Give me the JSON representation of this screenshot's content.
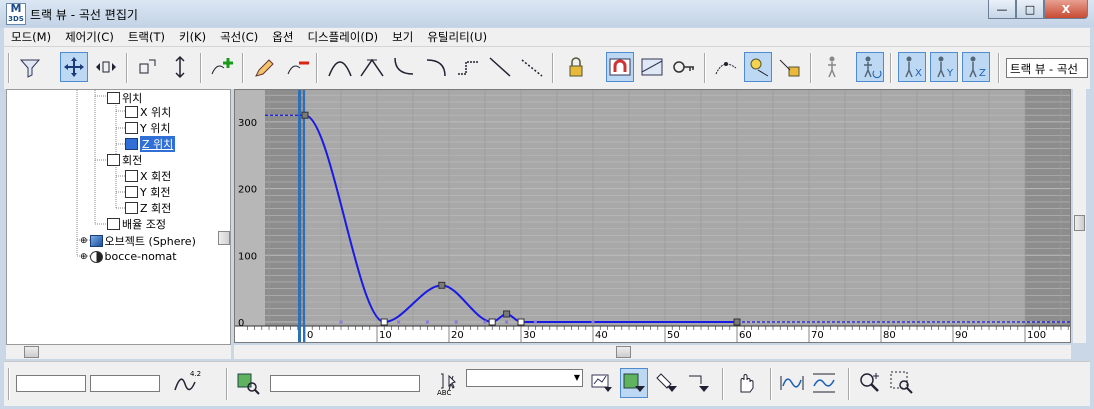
{
  "window": {
    "app_icon_text": "3DS",
    "title": "트랙 뷰 - 곡선 편집기",
    "minimize_glyph": "—",
    "maximize_glyph": "□",
    "close_glyph": "X"
  },
  "menu": [
    "모드(M)",
    "제어기(C)",
    "트랙(T)",
    "키(K)",
    "곡선(C)",
    "옵션",
    "디스플레이(D)",
    "보기",
    "유틸리티(U)"
  ],
  "toolbar": {
    "track_view_field": "트랙 뷰 - 곡선"
  },
  "tree": [
    {
      "label": "위치",
      "icon": "position-track-icon",
      "selected": false
    },
    {
      "label": "X 위치",
      "icon": "curve-track-icon",
      "selected": false
    },
    {
      "label": "Y 위치",
      "icon": "curve-track-icon",
      "selected": false
    },
    {
      "label": "Z 위치",
      "icon": "curve-track-icon",
      "selected": true
    },
    {
      "label": "회전",
      "icon": "rotation-track-icon",
      "selected": false
    },
    {
      "label": "X 회전",
      "icon": "curve-track-icon",
      "selected": false
    },
    {
      "label": "Y 회전",
      "icon": "curve-track-icon",
      "selected": false
    },
    {
      "label": "Z 회전",
      "icon": "curve-track-icon",
      "selected": false
    },
    {
      "label": "배율 조정",
      "icon": "scale-track-icon",
      "selected": false
    },
    {
      "label": "오브젝트 (Sphere)",
      "icon": "object-icon",
      "selected": false
    },
    {
      "label": "bocce-nomat",
      "icon": "material-icon",
      "selected": false
    }
  ],
  "graph": {
    "y_ticks": [
      "300",
      "200",
      "100",
      "0"
    ],
    "x_ticks": [
      "0",
      "10",
      "20",
      "30",
      "40",
      "50",
      "60",
      "70",
      "80",
      "90",
      "100"
    ],
    "curve_color": "#1a1ae6",
    "grid_color": "#bdbdbd",
    "current_frame": 0,
    "keys": [
      {
        "frame": 0,
        "value": 310
      },
      {
        "frame": 11,
        "value": 0
      },
      {
        "frame": 19,
        "value": 55
      },
      {
        "frame": 26,
        "value": 0
      },
      {
        "frame": 28,
        "value": 12
      },
      {
        "frame": 30,
        "value": 0
      },
      {
        "frame": 60,
        "value": 0
      }
    ]
  },
  "status": {
    "key_icon_label": "4.2",
    "abc_label": "ABC"
  }
}
